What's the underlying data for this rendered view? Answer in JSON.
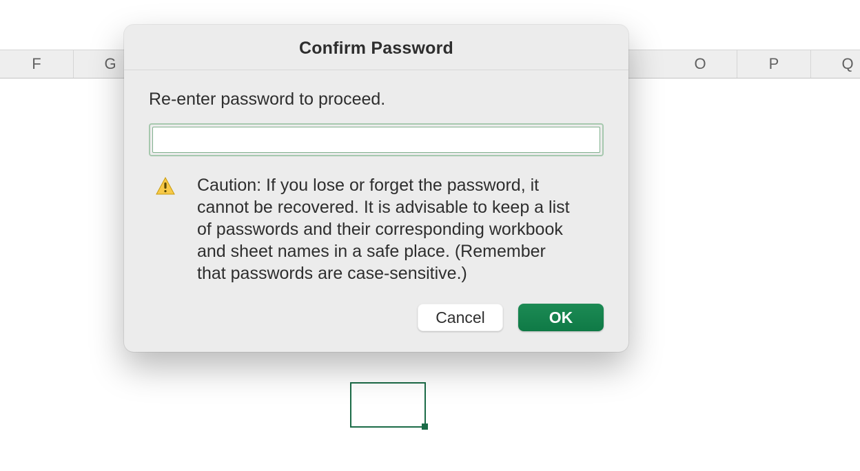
{
  "spreadsheet": {
    "visible_column_headers": [
      "F",
      "G",
      "",
      "",
      "",
      "",
      "",
      "",
      "",
      "O",
      "P",
      "Q"
    ]
  },
  "dialog": {
    "title": "Confirm Password",
    "prompt": "Re-enter password to proceed.",
    "password_value": "",
    "caution": "Caution: If you lose or forget the password, it cannot be recovered. It is advisable to keep a list of passwords and their corresponding workbook and sheet names in a safe place. (Remember that passwords are case-sensitive.)",
    "buttons": {
      "cancel": "Cancel",
      "ok": "OK"
    }
  }
}
